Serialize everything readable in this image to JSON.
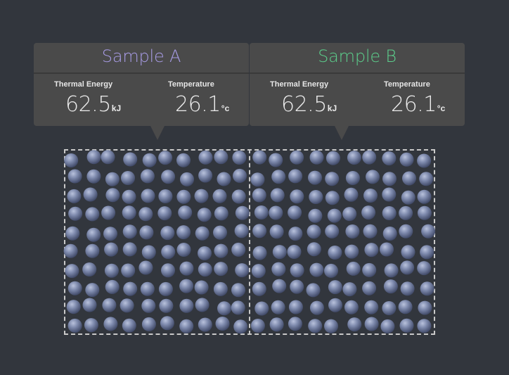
{
  "samples": [
    {
      "title": "Sample A",
      "title_color": "#a89ce6",
      "thermal_energy_label": "Thermal Energy",
      "thermal_energy_value": "62.5",
      "thermal_energy_unit": "kJ",
      "temperature_label": "Temperature",
      "temperature_value": "26.1",
      "temperature_unit": "°c"
    },
    {
      "title": "Sample B",
      "title_color": "#5ccf8c",
      "thermal_energy_label": "Thermal Energy",
      "thermal_energy_value": "62.5",
      "thermal_energy_unit": "kJ",
      "temperature_label": "Temperature",
      "temperature_value": "26.1",
      "temperature_unit": "°c"
    }
  ],
  "colors": {
    "background": "#32363d",
    "panel": "#4a4a4a",
    "particle": "#7a86a8",
    "container_border": "#c9c9c9"
  }
}
